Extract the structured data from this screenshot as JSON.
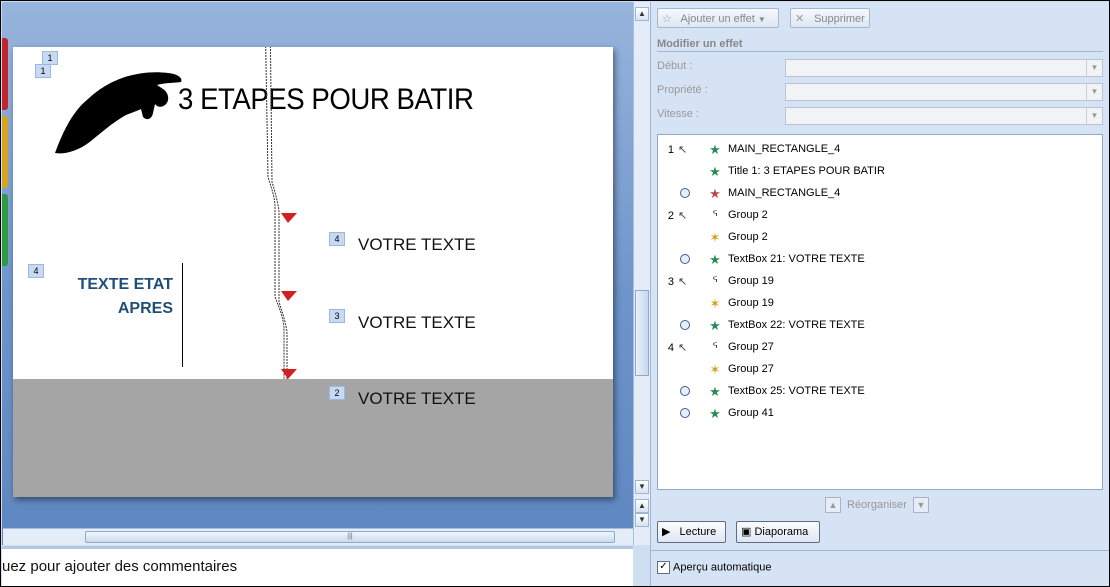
{
  "slide": {
    "title": "3 ETAPES POUR BATIR",
    "tags": {
      "t1a": "1",
      "t1b": "1",
      "t4_left": "4",
      "t4": "4",
      "t3": "3",
      "t2": "2"
    },
    "apres_line1": "TEXTE ETAT",
    "apres_line2": "APRES",
    "text_a": "VOTRE TEXTE",
    "text_b": "VOTRE TEXTE",
    "text_c": "VOTRE TEXTE"
  },
  "notes": {
    "placeholder": "uez pour ajouter des commentaires"
  },
  "pane": {
    "add_effect": "Ajouter un effet",
    "delete": "Supprimer",
    "section_title": "Modifier un effet",
    "fields": {
      "start": "Début :",
      "property": "Propriété :",
      "speed": "Vitesse :"
    },
    "effects": [
      {
        "num": "1",
        "trigger": "click",
        "icon": "entrance-star-icon",
        "label": "MAIN_RECTANGLE_4"
      },
      {
        "num": "",
        "trigger": "",
        "icon": "entrance-star-icon",
        "label": "Title 1: 3 ETAPES POUR BATIR"
      },
      {
        "num": "",
        "trigger": "clock",
        "icon": "exit-star-icon",
        "label": "MAIN_RECTANGLE_4"
      },
      {
        "num": "2",
        "trigger": "click",
        "icon": "motion-path-icon",
        "label": "Group 2"
      },
      {
        "num": "",
        "trigger": "",
        "icon": "emphasis-star-icon",
        "label": "Group 2"
      },
      {
        "num": "",
        "trigger": "clock",
        "icon": "entrance-star-icon",
        "label": "TextBox 21: VOTRE TEXTE"
      },
      {
        "num": "3",
        "trigger": "click",
        "icon": "motion-path-icon",
        "label": "Group 19"
      },
      {
        "num": "",
        "trigger": "",
        "icon": "emphasis-star-icon",
        "label": "Group 19"
      },
      {
        "num": "",
        "trigger": "clock",
        "icon": "entrance-star-icon",
        "label": "TextBox 22: VOTRE TEXTE"
      },
      {
        "num": "4",
        "trigger": "click",
        "icon": "motion-path-icon",
        "label": "Group 27"
      },
      {
        "num": "",
        "trigger": "",
        "icon": "emphasis-star-icon",
        "label": "Group 27"
      },
      {
        "num": "",
        "trigger": "clock",
        "icon": "entrance-star-icon",
        "label": "TextBox 25: VOTRE TEXTE"
      },
      {
        "num": "",
        "trigger": "clock",
        "icon": "entrance-star-icon",
        "label": "Group 41"
      }
    ],
    "reorder": "Réorganiser",
    "play": "Lecture",
    "slideshow": "Diaporama",
    "autopreview": "Aperçu automatique",
    "autopreview_checked": true
  }
}
